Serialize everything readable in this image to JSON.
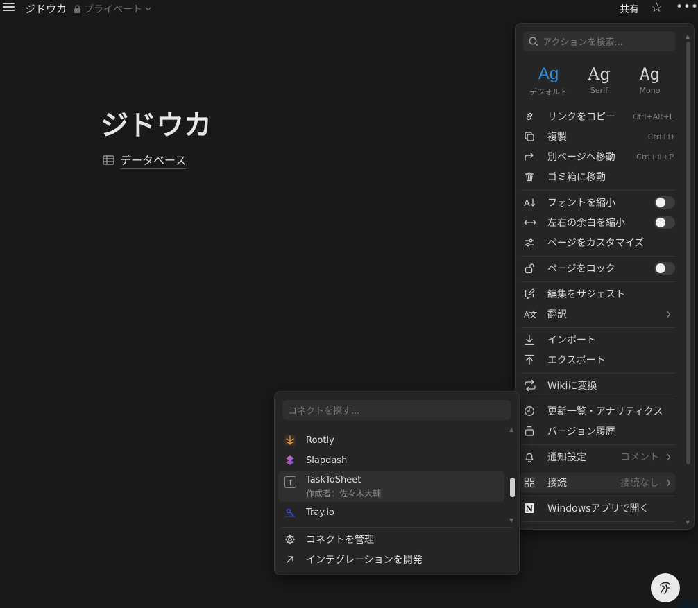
{
  "topbar": {
    "page_title": "ジドウカ",
    "privacy_label": "プライベート",
    "share_label": "共有"
  },
  "page": {
    "title": "ジドウカ",
    "database_link": "データベース"
  },
  "menu": {
    "search_placeholder": "アクションを検索...",
    "fonts": [
      {
        "sample": "Ag",
        "caption": "デフォルト"
      },
      {
        "sample": "Ag",
        "caption": "Serif"
      },
      {
        "sample": "Ag",
        "caption": "Mono"
      }
    ],
    "items": {
      "copy_link": {
        "label": "リンクをコピー",
        "shortcut": "Ctrl+Alt+L"
      },
      "duplicate": {
        "label": "複製",
        "shortcut": "Ctrl+D"
      },
      "move_to": {
        "label": "別ページへ移動",
        "shortcut": "Ctrl+⇧+P"
      },
      "trash": {
        "label": "ゴミ箱に移動"
      },
      "small_text": {
        "label": "フォントを縮小",
        "toggle_on": false
      },
      "full_width": {
        "label": "左右の余白を縮小",
        "toggle_on": false
      },
      "customize": {
        "label": "ページをカスタマイズ"
      },
      "lock": {
        "label": "ページをロック",
        "toggle_on": false
      },
      "suggest": {
        "label": "編集をサジェスト"
      },
      "translate": {
        "label": "翻訳"
      },
      "import": {
        "label": "インポート"
      },
      "export": {
        "label": "エクスポート"
      },
      "wiki": {
        "label": "Wikiに変換"
      },
      "updates": {
        "label": "更新一覧・アナリティクス"
      },
      "history": {
        "label": "バージョン履歴"
      },
      "notify": {
        "label": "通知設定",
        "value": "コメント"
      },
      "connect": {
        "label": "接続",
        "value": "接続なし"
      },
      "open_app": {
        "label": "Windowsアプリで開く"
      }
    }
  },
  "connect_menu": {
    "search_placeholder": "コネクトを探す...",
    "items": [
      {
        "name": "Rootly"
      },
      {
        "name": "Slapdash"
      },
      {
        "name": "TaskToSheet",
        "sub": "作成者：佐々木大輔"
      },
      {
        "name": "Tray.io"
      }
    ],
    "manage_label": "コネクトを管理",
    "develop_label": "インテグレーションを開発"
  }
}
